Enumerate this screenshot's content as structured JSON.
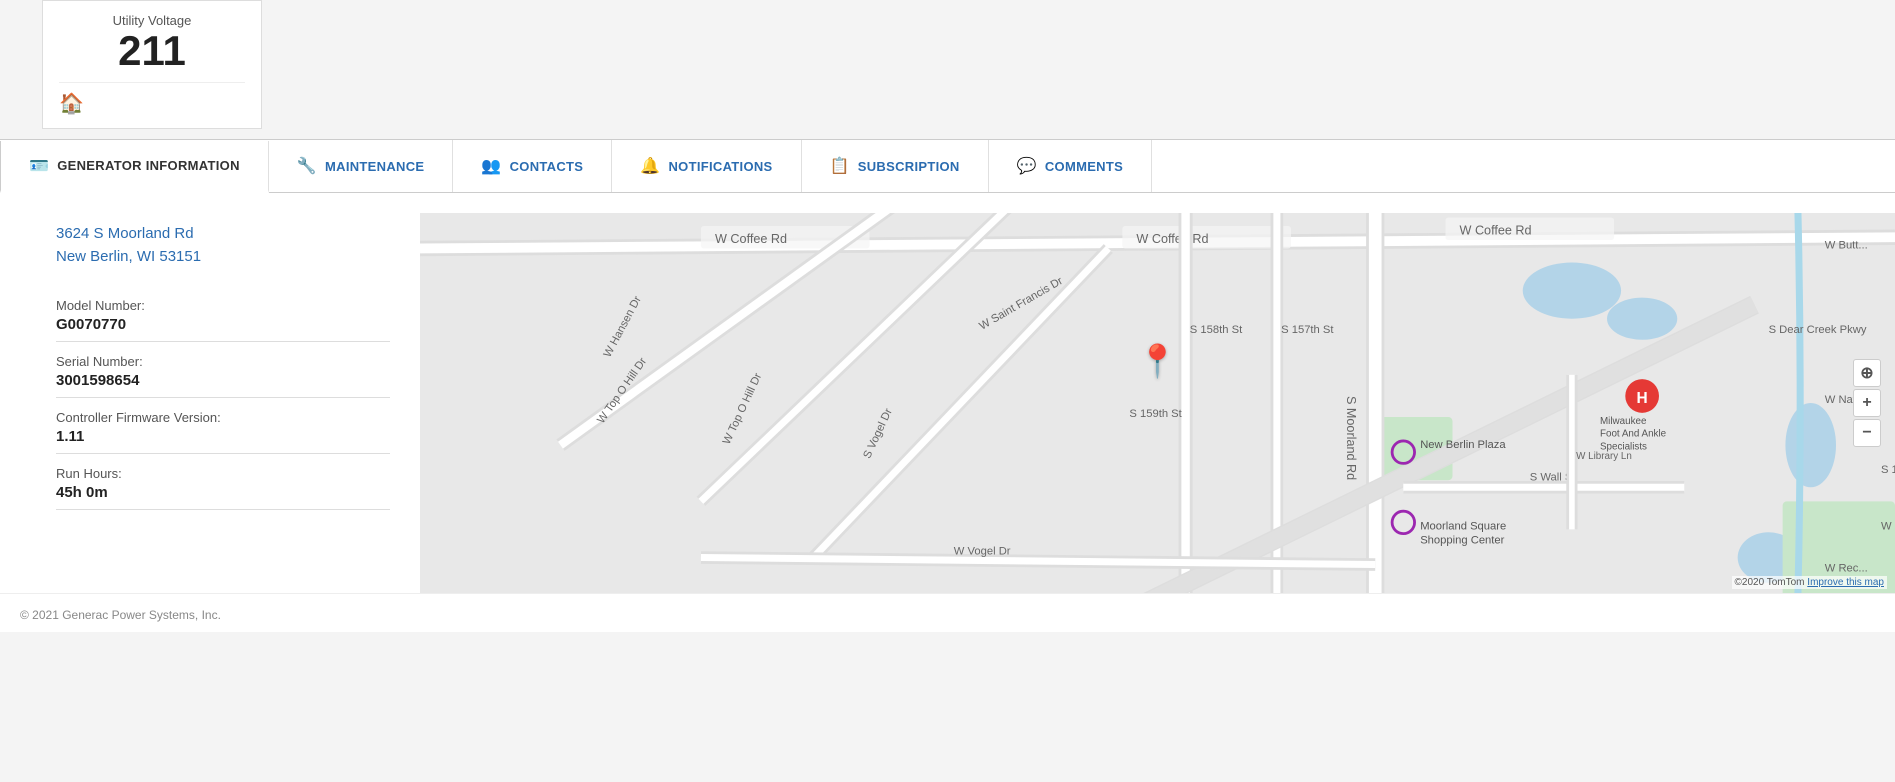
{
  "voltage_card": {
    "label": "Utility Voltage",
    "value": "211"
  },
  "tabs": [
    {
      "id": "generator-information",
      "label": "GENERATOR INFORMATION",
      "icon": "person-card",
      "active": true
    },
    {
      "id": "maintenance",
      "label": "MAINTENANCE",
      "icon": "wrench",
      "active": false
    },
    {
      "id": "contacts",
      "label": "CONTACTS",
      "icon": "people",
      "active": false
    },
    {
      "id": "notifications",
      "label": "NOTIFICATIONS",
      "icon": "bell",
      "active": false
    },
    {
      "id": "subscription",
      "label": "SUBSCRIPTION",
      "icon": "subscribe",
      "active": false
    },
    {
      "id": "comments",
      "label": "COMMENTS",
      "icon": "chat",
      "active": false
    }
  ],
  "info": {
    "address_line1": "3624 S Moorland Rd",
    "address_line2": "New Berlin, WI 53151",
    "model_number_label": "Model Number:",
    "model_number_value": "G0070770",
    "serial_number_label": "Serial Number:",
    "serial_number_value": "3001598654",
    "firmware_label": "Controller Firmware Version:",
    "firmware_value": "1.11",
    "run_hours_label": "Run Hours:",
    "run_hours_value": "45h 0m"
  },
  "map": {
    "attribution": "©2020 TomTom",
    "improve_link": "Improve this map"
  },
  "footer": {
    "copyright": "© 2021 Generac Power Systems, Inc."
  }
}
